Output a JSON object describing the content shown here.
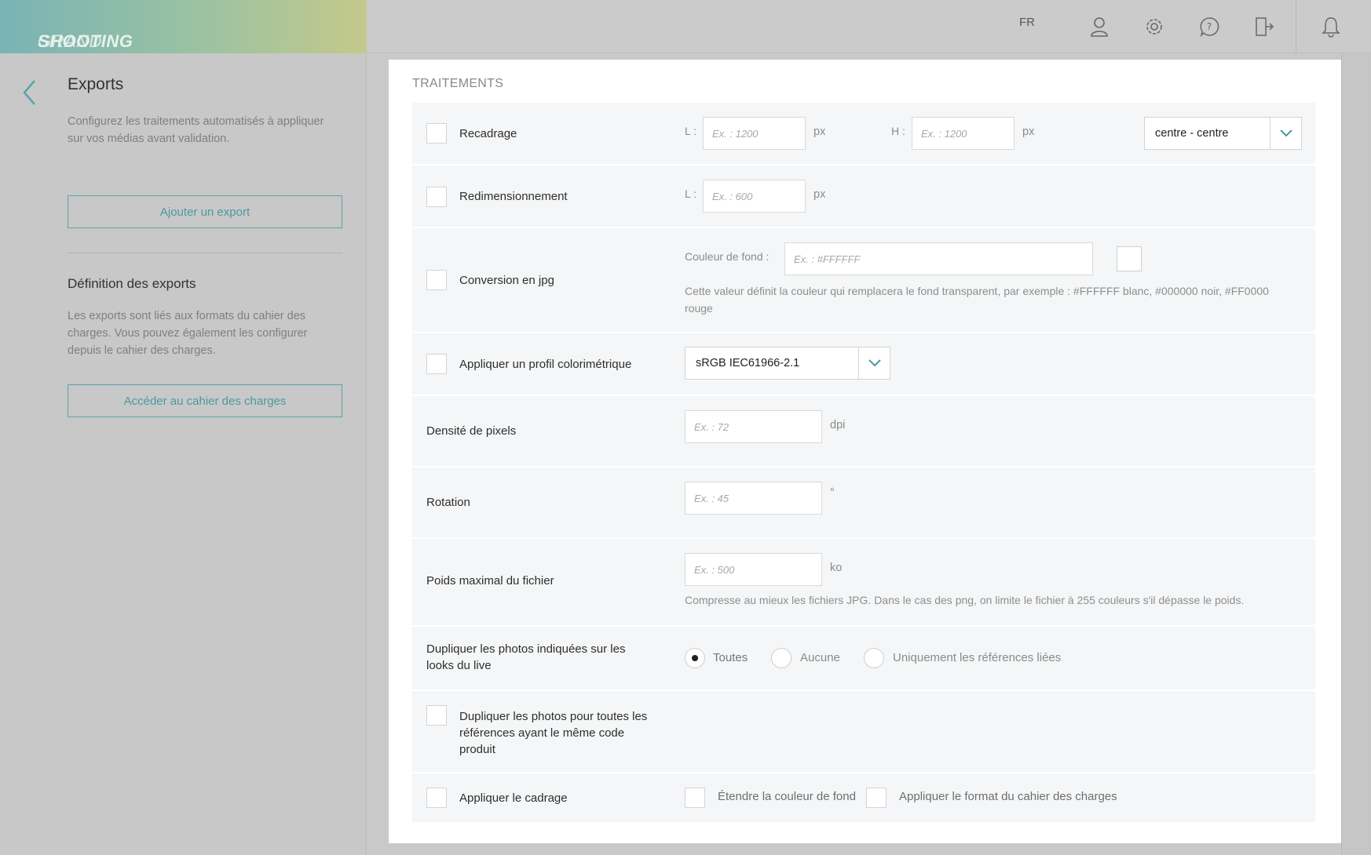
{
  "brand": {
    "light": "GRAND",
    "bold": "SHOOTING"
  },
  "topbar": {
    "lang": "FR"
  },
  "sidebar": {
    "title": "Exports",
    "description": "Configurez les traitements automatisés à appliquer sur vos médias avant validation.",
    "add_button": "Ajouter un export",
    "definition_title": "Définition des exports",
    "definition_text": "Les exports sont liés aux formats du cahier des charges. Vous pouvez également les configurer depuis le cahier des charges.",
    "charges_button": "Accéder au cahier des charges"
  },
  "panel": {
    "title": "TRAITEMENTS",
    "recadrage": {
      "label": "Recadrage",
      "l_label": "L :",
      "l_placeholder": "Ex. : 1200",
      "l_unit": "px",
      "h_label": "H :",
      "h_placeholder": "Ex. : 1200",
      "h_unit": "px",
      "position_value": "centre - centre"
    },
    "redim": {
      "label": "Redimensionnement",
      "l_label": "L :",
      "l_placeholder": "Ex. : 600",
      "l_unit": "px"
    },
    "jpg": {
      "label": "Conversion en jpg",
      "bg_label": "Couleur de fond :",
      "bg_placeholder": "Ex. : #FFFFFF",
      "help": "Cette valeur définit la couleur qui remplacera le fond transparent, par exemple : #FFFFFF blanc, #000000 noir, #FF0000 rouge"
    },
    "profil": {
      "label": "Appliquer un profil colorimétrique",
      "value": "sRGB IEC61966-2.1"
    },
    "densite": {
      "label": "Densité de pixels",
      "placeholder": "Ex. : 72",
      "unit": "dpi"
    },
    "rotation": {
      "label": "Rotation",
      "placeholder": "Ex. : 45",
      "unit": "°"
    },
    "poids": {
      "label": "Poids maximal du fichier",
      "placeholder": "Ex. : 500",
      "unit": "ko",
      "help": "Compresse au mieux les fichiers JPG. Dans le cas des png, on limite le fichier à 255 couleurs s'il dépasse le poids."
    },
    "dupliquer_live": {
      "label": "Dupliquer les photos indiquées sur les looks du live",
      "options": [
        "Toutes",
        "Aucune",
        "Uniquement les références liées"
      ],
      "selected": "Toutes"
    },
    "dupliquer_refs": {
      "label": "Dupliquer les photos pour toutes les références ayant le même code produit"
    },
    "cadrage": {
      "label": "Appliquer le cadrage",
      "extend_label": "Étendre la couleur de fond",
      "format_label": "Appliquer le format du cahier des charges"
    }
  },
  "colors": {
    "accent": "#4a9aa0",
    "panel_bg": "#ffffff",
    "row_bg": "#f5f6f7"
  }
}
